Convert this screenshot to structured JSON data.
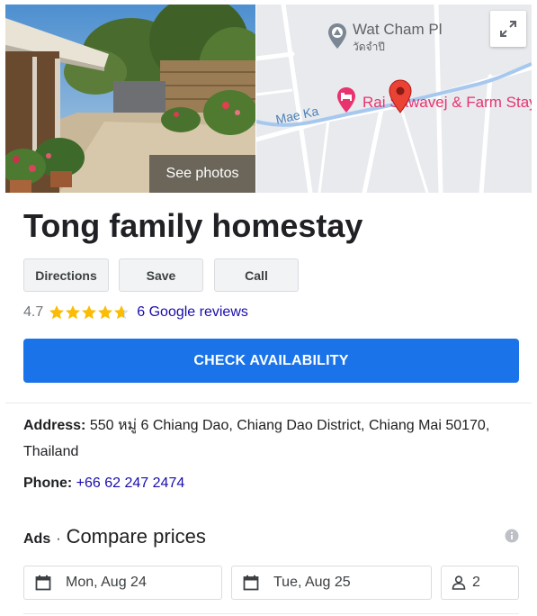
{
  "hero": {
    "see_photos_label": "See photos",
    "map": {
      "poi_wat_name": "Wat Cham Pl",
      "poi_wat_thai": "วัดจำปี",
      "poi_hotel_name": "Rai Sawavej & Farm Stay",
      "road_name": "Mae Ka"
    }
  },
  "place": {
    "title": "Tong family homestay"
  },
  "actions": {
    "directions_label": "Directions",
    "save_label": "Save",
    "call_label": "Call"
  },
  "rating": {
    "value": "4.7",
    "stars_filled": 4.7,
    "reviews_label": "6 Google reviews"
  },
  "check_availability_label": "CHECK AVAILABILITY",
  "details": {
    "address_label": "Address:",
    "address_value": "550 หมู่ 6 Chiang Dao, Chiang Dao District, Chiang Mai 50170, Thailand",
    "phone_label": "Phone:",
    "phone_value": "+66 62 247 2474"
  },
  "ads": {
    "ads_label": "Ads",
    "separator": "·",
    "compare_label": "Compare prices",
    "check_in": "Mon, Aug 24",
    "check_out": "Tue, Aug 25",
    "guests": "2"
  },
  "colors": {
    "primary_button": "#1a73e8",
    "link": "#1a0dab",
    "star": "#fbbc04",
    "map_pin": "#ea4335",
    "hotel_pink": "#e8336f"
  },
  "icons": {
    "expand": "expand-icon",
    "wat_poi": "temple-pin-icon",
    "hotel_poi": "hotel-pin-icon",
    "location_pin": "location-pin-icon",
    "star": "star-icon",
    "info": "info-icon",
    "calendar": "calendar-icon",
    "person": "person-icon"
  }
}
